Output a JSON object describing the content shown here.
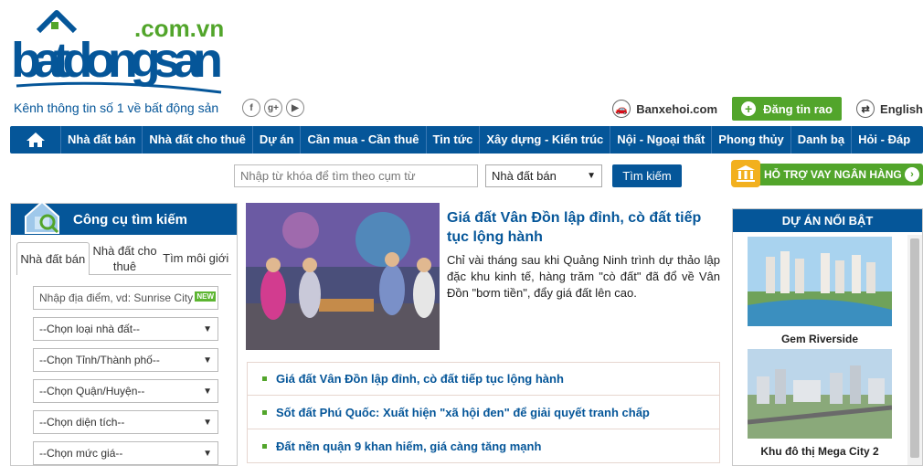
{
  "header": {
    "logo_text": "batdongsan",
    "logo_domain": ".com.vn",
    "tagline": "Kênh thông tin số 1 về bất động sản",
    "social": [
      {
        "icon": "facebook-icon",
        "glyph": "f"
      },
      {
        "icon": "googleplus-icon",
        "glyph": "g+"
      },
      {
        "icon": "youtube-icon",
        "glyph": "▶"
      }
    ],
    "banxehoi": "Banxehoi.com",
    "post_button": "Đăng tin rao",
    "language": "English"
  },
  "nav": {
    "items": [
      "Nhà đất bán",
      "Nhà đất cho thuê",
      "Dự án",
      "Cần mua - Cần thuê",
      "Tin tức",
      "Xây dựng - Kiến trúc",
      "Nội - Ngoại thất",
      "Phong thủy",
      "Danh bạ",
      "Hỏi - Đáp"
    ]
  },
  "search": {
    "placeholder": "Nhập từ khóa để tìm theo cụm từ",
    "category": "Nhà đất bán",
    "button": "Tìm kiếm"
  },
  "loan_banner": "HỖ TRỢ VAY NGÂN HÀNG",
  "search_tool": {
    "title": "Công cụ tìm kiếm",
    "tabs": [
      {
        "label": "Nhà đất bán",
        "active": true
      },
      {
        "label": "Nhà đất cho thuê",
        "active": false
      },
      {
        "label": "Tìm môi giới",
        "active": false
      }
    ],
    "location_placeholder": "Nhập địa điểm, vd: Sunrise City",
    "new_badge": "NEW",
    "dropdowns": [
      "--Chọn loại nhà đất--",
      "--Chọn Tỉnh/Thành phố--",
      "--Chọn Quận/Huyện--",
      "--Chọn diện tích--",
      "--Chọn mức giá--"
    ]
  },
  "featured": {
    "title": "Giá đất Vân Đồn lập đỉnh, cò đất tiếp tục lộng hành",
    "description": "Chỉ vài tháng sau khi Quảng Ninh trình dự thảo lập đặc khu kinh tế, hàng trăm \"cò đất\" đã đổ về Vân Đồn \"bơm tiền\", đẩy giá đất lên cao."
  },
  "news": [
    "Giá đất Vân Đồn lập đỉnh, cò đất tiếp tục lộng hành",
    "Sốt đất Phú Quốc: Xuất hiện \"xã hội đen\" để giải quyết tranh chấp",
    "Đất nền quận 9 khan hiếm, giá càng tăng mạnh"
  ],
  "projects": {
    "title": "DỰ ÁN NỔI BẬT",
    "items": [
      {
        "name": "Gem Riverside"
      },
      {
        "name": "Khu đô thị Mega City 2"
      }
    ]
  },
  "colors": {
    "brand_blue": "#055699",
    "green": "#52a52b",
    "gold": "#f2b01e"
  }
}
